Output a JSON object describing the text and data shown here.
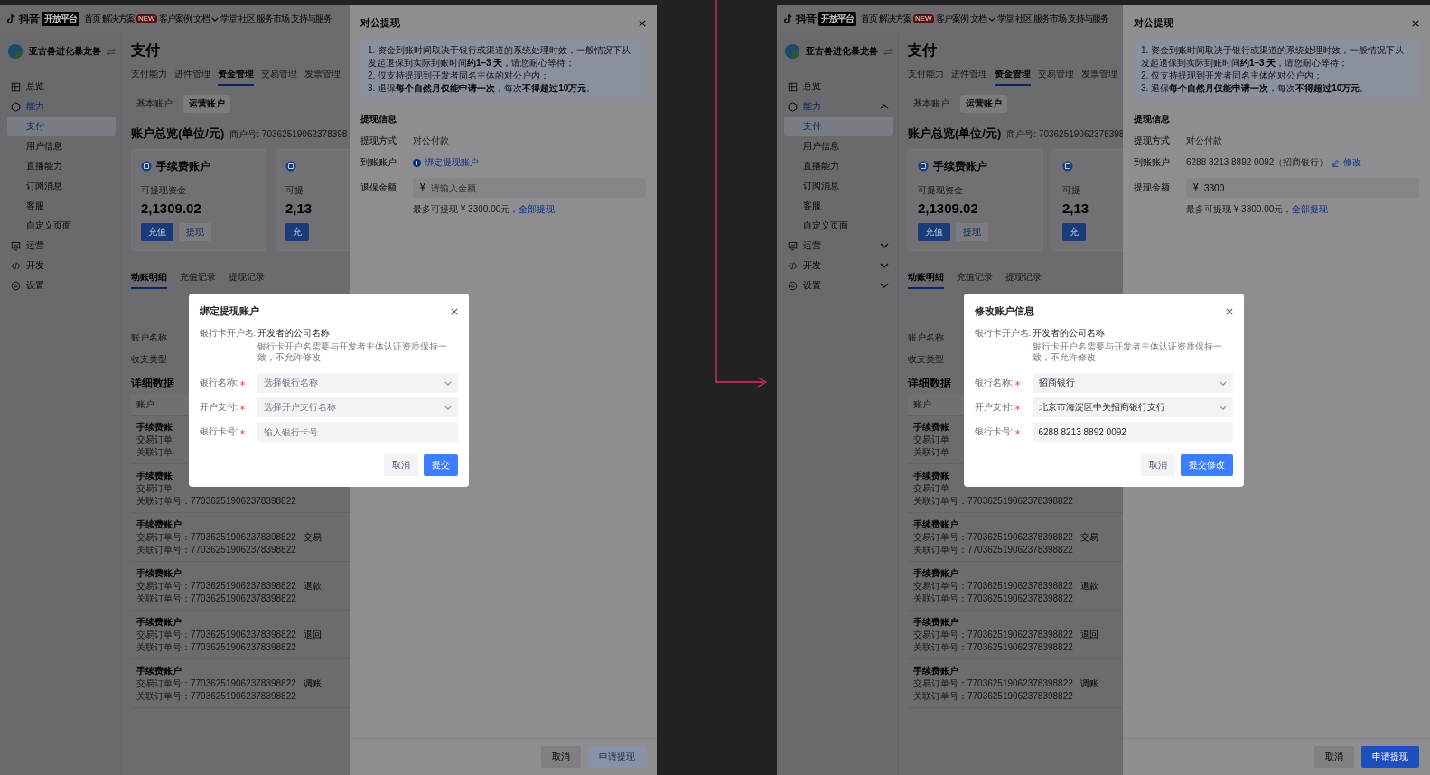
{
  "screens": [
    {
      "nav": {
        "logo": "抖音",
        "badge": "开放平台",
        "items": [
          {
            "label": "首页"
          },
          {
            "label": "解决方案",
            "tag": "NEW"
          },
          {
            "label": "客户案例"
          },
          {
            "label": "文档",
            "dropdown": true
          },
          {
            "label": "学堂"
          },
          {
            "label": "社区"
          },
          {
            "label": "服务市场"
          },
          {
            "label": "支持与服务"
          }
        ]
      },
      "sidebar": {
        "account": "亚古兽进化暴龙兽",
        "show_chevrons": false,
        "items": [
          {
            "label": "总览",
            "selected": false
          },
          {
            "label": "能力",
            "selected": true,
            "children": [
              {
                "label": "支付",
                "selected": true
              },
              {
                "label": "用户信息",
                "selected": false
              },
              {
                "label": "直播能力",
                "selected": false
              },
              {
                "label": "订阅消息",
                "selected": false
              },
              {
                "label": "客服",
                "selected": false
              },
              {
                "label": "自定义页面",
                "selected": false
              }
            ]
          },
          {
            "label": "运营",
            "selected": false
          },
          {
            "label": "开发",
            "selected": false
          },
          {
            "label": "设置",
            "selected": false
          }
        ]
      },
      "main": {
        "title": "支付",
        "tabs": [
          {
            "label": "支付能力",
            "selected": false
          },
          {
            "label": "进件管理",
            "selected": false
          },
          {
            "label": "资金管理",
            "selected": true
          },
          {
            "label": "交易管理",
            "selected": false
          },
          {
            "label": "发票管理",
            "selected": false
          }
        ],
        "subtabs": [
          {
            "label": "基本账户",
            "selected": false
          },
          {
            "label": "运营账户",
            "selected": true
          }
        ],
        "overview_title": "账户总览(单位/元)",
        "merchant_no": "商户号: 70362519062378398",
        "cards": [
          {
            "title": "手续费账户",
            "label": "可提现资金",
            "amount": "2,1309.02",
            "buttons": [
              "充值",
              "提现"
            ]
          },
          {
            "label": "可提",
            "amount": "2,13",
            "buttons": [
              "充"
            ]
          }
        ],
        "detail_tabs": [
          {
            "label": "动账明细",
            "selected": true
          },
          {
            "label": "充值记录",
            "selected": false
          },
          {
            "label": "提现记录",
            "selected": false
          }
        ],
        "filters": [
          "账户名称",
          "收支类型"
        ],
        "detail_title": "详细数据",
        "table_header": "账户",
        "rows": [
          {
            "account": "手续费账",
            "trade_no": "交易订单",
            "related_no": "关联订单"
          },
          {
            "account": "手续费账",
            "trade_no": "交易订单",
            "related_no": "关联订单号：770362519062378398822"
          },
          {
            "account": "手续费账户",
            "trade_no": "交易订单号：770362519062378398822",
            "related_no": "关联订单号：770362519062378398822",
            "type": "交易"
          },
          {
            "account": "手续费账户",
            "trade_no": "交易订单号：770362519062378398822",
            "related_no": "关联订单号：770362519062378398822",
            "type": "退款"
          },
          {
            "account": "手续费账户",
            "trade_no": "交易订单号：770362519062378398822",
            "related_no": "关联订单号：770362519062378398822",
            "type": "退回"
          },
          {
            "account": "手续费账户",
            "trade_no": "交易订单号：770362519062378398822",
            "related_no": "关联订单号：770362519062378398822",
            "type": "调账"
          }
        ]
      },
      "drawer": {
        "title": "对公提现",
        "notes": [
          "1. 资金到账时间取决于银行或渠道的系统处理时效，一般情况下从发起退保到实际到账时间**约1–3 天**，请您耐心等待；",
          "2. 仅支持提现到开发者同名主体的对公户内；",
          "3. 退保**每个自然月仅能申请一次**，每次**不得超过10万元**。"
        ],
        "section": "提现信息",
        "method_label": "提现方式",
        "method": "对公付款",
        "account_label": "到账账户",
        "account": {
          "kind": "bind",
          "link": "绑定提现账户"
        },
        "amount_label": "退保金额",
        "amount_field": {
          "prefix": "¥",
          "placeholder": "请输入金额"
        },
        "limit_text": "最多可提现 ¥ 3300.00元，",
        "limit_link": "全部提现",
        "cancel": "取消",
        "submit": {
          "label": "申请提现",
          "disabled": true
        }
      },
      "modal": {
        "title": "绑定提现账户",
        "owner_label": "银行卡开户名:",
        "owner": "开发者的公司名称",
        "owner_hint": "银行卡开户名需要与开发者主体认证资质保持一致，不允许修改",
        "fields": [
          {
            "label": "银行名称:",
            "required": true,
            "kind": "select",
            "placeholder": "选择银行名称"
          },
          {
            "label": "开户支付:",
            "required": true,
            "kind": "select",
            "placeholder": "选择开户支行名称"
          },
          {
            "label": "银行卡号:",
            "required": true,
            "kind": "input",
            "placeholder": "输入银行卡号"
          }
        ],
        "cancel": "取消",
        "submit": "提交"
      }
    },
    {
      "nav": {
        "logo": "抖音",
        "badge": "开放平台",
        "items": [
          {
            "label": "首页"
          },
          {
            "label": "解决方案",
            "tag": "NEW"
          },
          {
            "label": "客户案例"
          },
          {
            "label": "文档",
            "dropdown": true
          },
          {
            "label": "学堂"
          },
          {
            "label": "社区"
          },
          {
            "label": "服务市场"
          },
          {
            "label": "支持与服务"
          }
        ]
      },
      "sidebar": {
        "account": "亚古兽进化暴龙兽",
        "show_chevrons": true,
        "items": [
          {
            "label": "总览",
            "selected": false
          },
          {
            "label": "能力",
            "selected": true,
            "children": [
              {
                "label": "支付",
                "selected": true
              },
              {
                "label": "用户信息",
                "selected": false
              },
              {
                "label": "直播能力",
                "selected": false
              },
              {
                "label": "订阅消息",
                "selected": false
              },
              {
                "label": "客服",
                "selected": false
              },
              {
                "label": "自定义页面",
                "selected": false
              }
            ]
          },
          {
            "label": "运营",
            "selected": false
          },
          {
            "label": "开发",
            "selected": false
          },
          {
            "label": "设置",
            "selected": false
          }
        ]
      },
      "main": {
        "title": "支付",
        "tabs": [
          {
            "label": "支付能力",
            "selected": false
          },
          {
            "label": "进件管理",
            "selected": false
          },
          {
            "label": "资金管理",
            "selected": true
          },
          {
            "label": "交易管理",
            "selected": false
          },
          {
            "label": "发票管理",
            "selected": false
          }
        ],
        "subtabs": [
          {
            "label": "基本账户",
            "selected": false
          },
          {
            "label": "运营账户",
            "selected": true
          }
        ],
        "overview_title": "账户总览(单位/元)",
        "merchant_no": "商户号: 70362519062378398",
        "cards": [
          {
            "title": "手续费账户",
            "label": "可提现资金",
            "amount": "2,1309.02",
            "buttons": [
              "充值",
              "提现"
            ]
          },
          {
            "label": "可提",
            "amount": "2,13",
            "buttons": [
              "充"
            ]
          }
        ],
        "detail_tabs": [
          {
            "label": "动账明细",
            "selected": true
          },
          {
            "label": "充值记录",
            "selected": false
          },
          {
            "label": "提现记录",
            "selected": false
          }
        ],
        "filters": [
          "账户名称",
          "收支类型"
        ],
        "detail_title": "详细数据",
        "table_header": "账户",
        "rows": [
          {
            "account": "手续费账",
            "trade_no": "交易订单",
            "related_no": "关联订单"
          },
          {
            "account": "手续费账",
            "trade_no": "交易订单",
            "related_no": "关联订单号：770362519062378398822"
          },
          {
            "account": "手续费账户",
            "trade_no": "交易订单号：770362519062378398822",
            "related_no": "关联订单号：770362519062378398822",
            "type": "交易"
          },
          {
            "account": "手续费账户",
            "trade_no": "交易订单号：770362519062378398822",
            "related_no": "关联订单号：770362519062378398822",
            "type": "退款"
          },
          {
            "account": "手续费账户",
            "trade_no": "交易订单号：770362519062378398822",
            "related_no": "关联订单号：770362519062378398822",
            "type": "退回"
          },
          {
            "account": "手续费账户",
            "trade_no": "交易订单号：770362519062378398822",
            "related_no": "关联订单号：770362519062378398822",
            "type": "调账"
          }
        ]
      },
      "drawer": {
        "title": "对公提现",
        "notes": [
          "1. 资金到账时间取决于银行或渠道的系统处理时效，一般情况下从发起退保到实际到账时间**约1–3 天**，请您耐心等待；",
          "2. 仅支持提现到开发者同名主体的对公户内；",
          "3. 退保**每个自然月仅能申请一次**，每次**不得超过10万元**。"
        ],
        "section": "提现信息",
        "method_label": "提现方式",
        "method": "对公付款",
        "account_label": "到账账户",
        "account": {
          "kind": "bound",
          "number": "6288 8213 8892 0092（招商银行）",
          "link": "修改"
        },
        "amount_label": "提现金额",
        "amount_field": {
          "prefix": "¥",
          "value": "3300"
        },
        "limit_text": "最多可提现 ¥ 3300.00元，",
        "limit_link": "全部提现",
        "cancel": "取消",
        "submit": {
          "label": "申请提现",
          "disabled": false
        }
      },
      "modal": {
        "title": "修改账户信息",
        "owner_label": "银行卡开户名:",
        "owner": "开发者的公司名称",
        "owner_hint": "银行卡开户名需要与开发者主体认证资质保持一致，不允许修改",
        "fields": [
          {
            "label": "银行名称:",
            "required": true,
            "kind": "select",
            "value": "招商银行"
          },
          {
            "label": "开户支付:",
            "required": true,
            "kind": "select",
            "value": "北京市海淀区中关招商银行支行"
          },
          {
            "label": "银行卡号:",
            "required": true,
            "kind": "input",
            "value": "6288 8213 8892 0092"
          }
        ],
        "cancel": "取消",
        "submit": "提交修改"
      }
    }
  ]
}
